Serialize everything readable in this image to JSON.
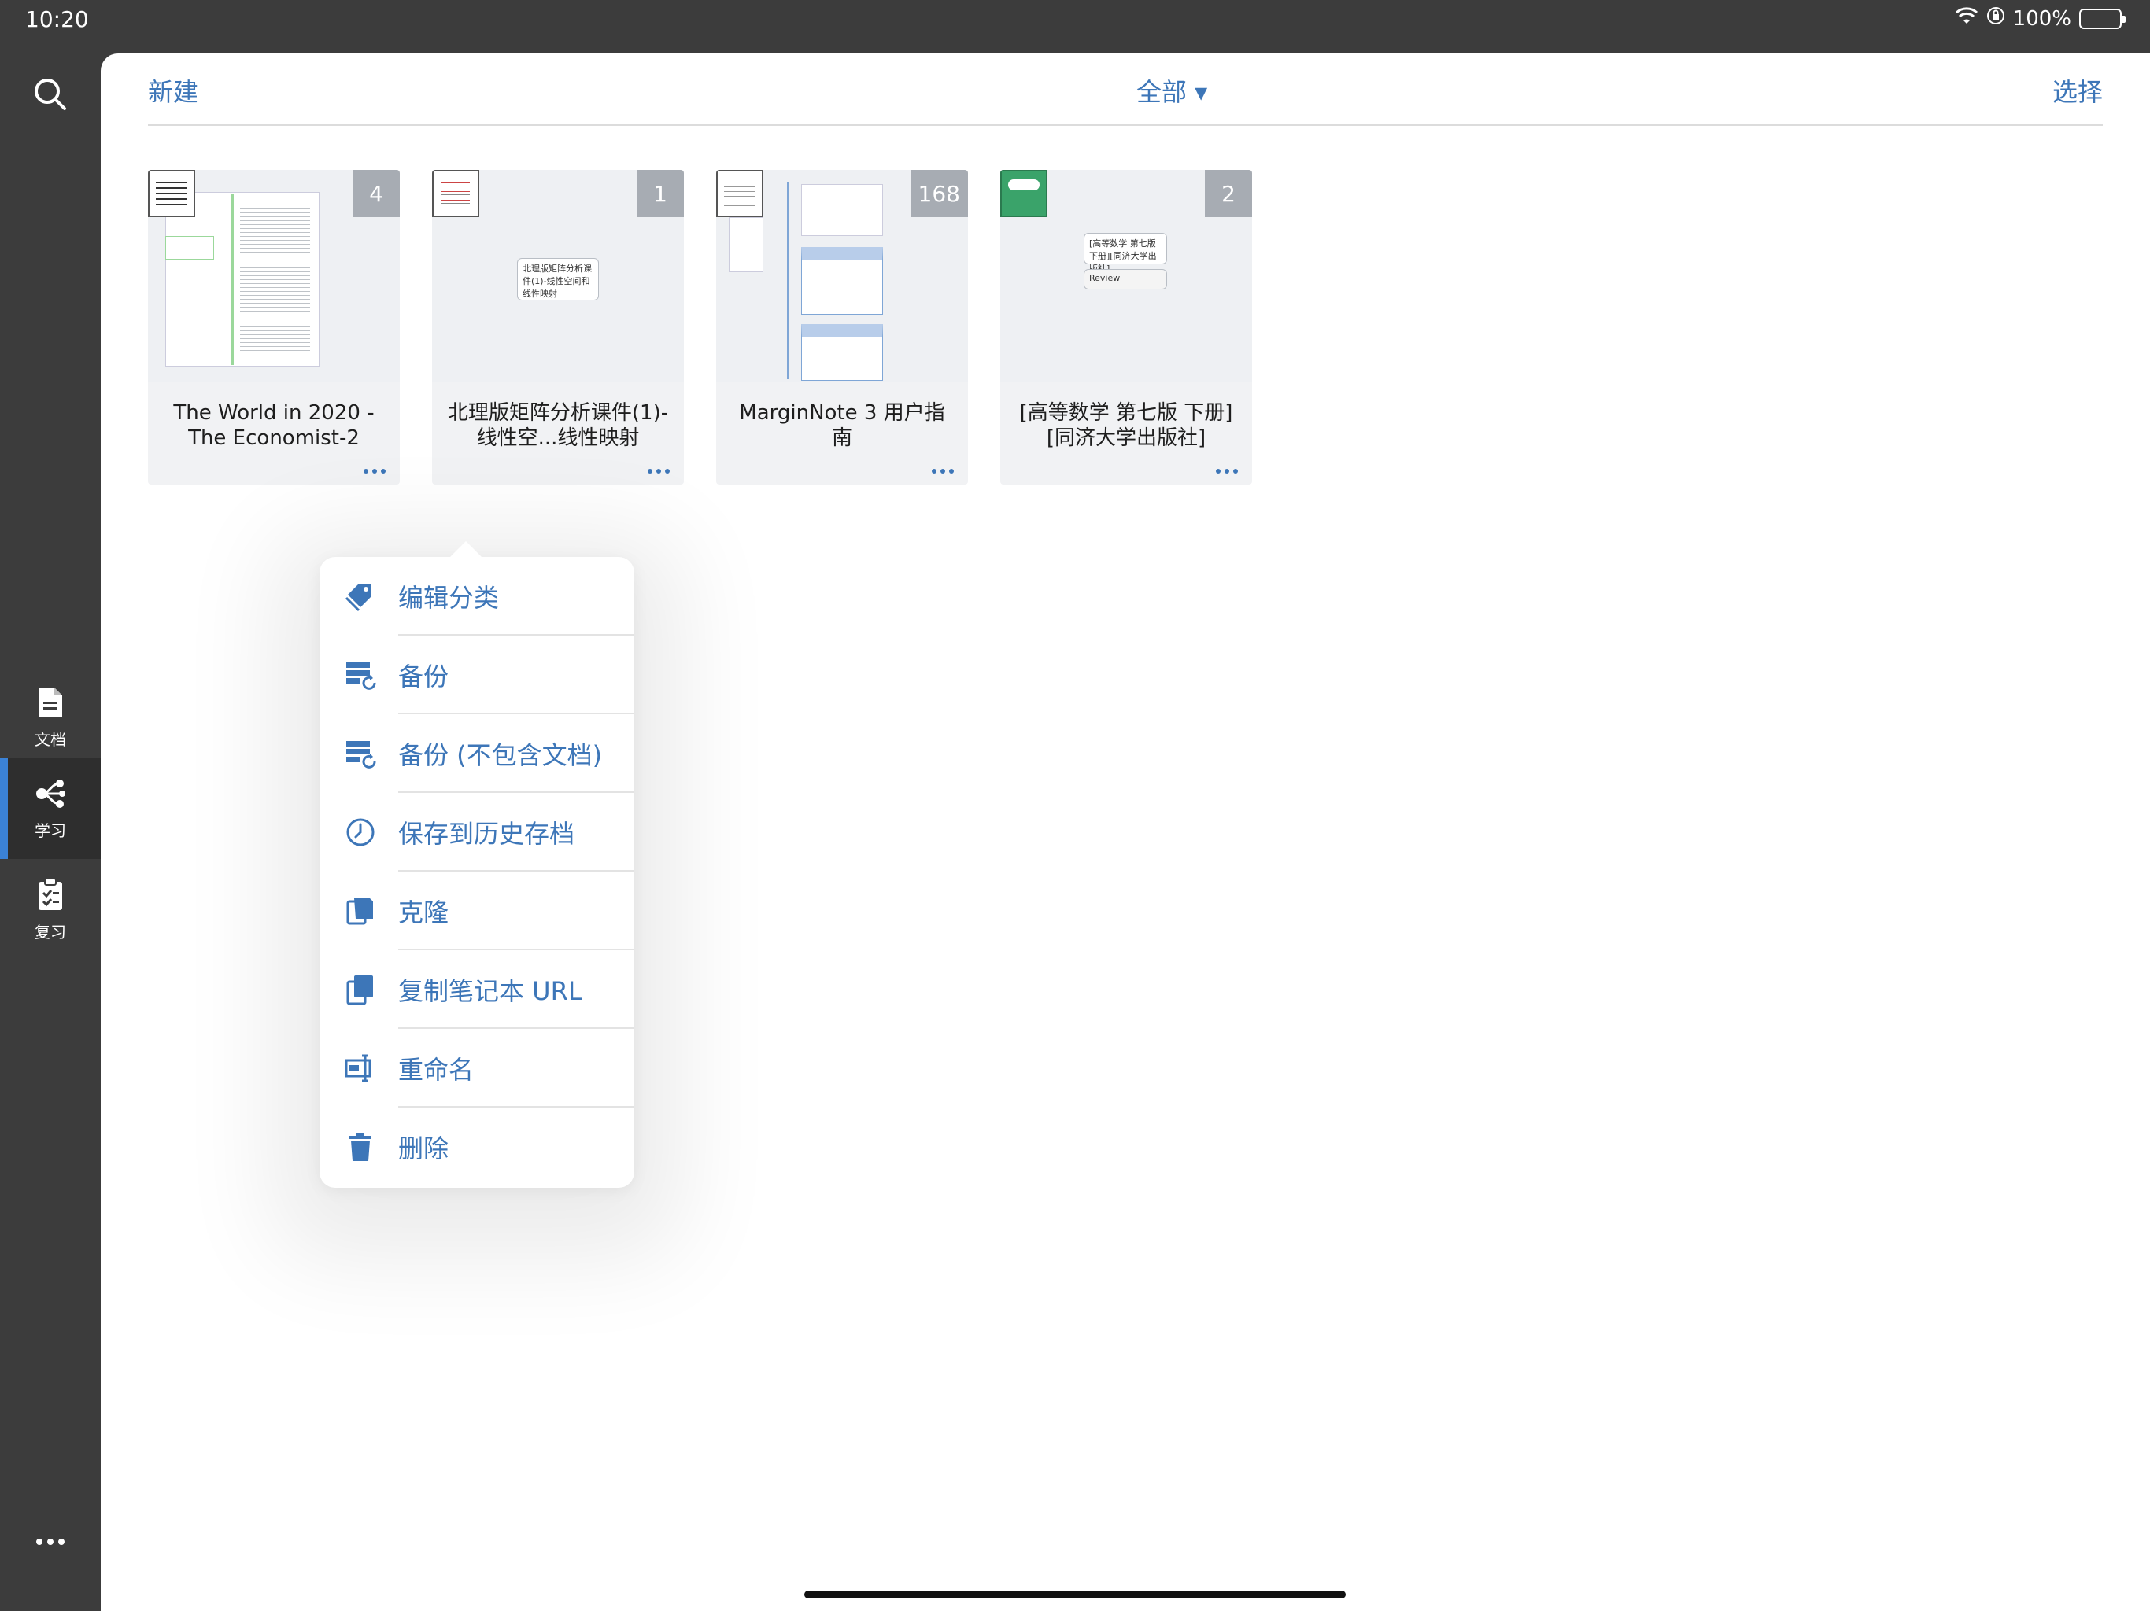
{
  "status": {
    "time": "10:20",
    "battery": "100%",
    "icons": [
      "wifi-icon",
      "orientation-lock-icon",
      "battery-icon"
    ]
  },
  "sidebar": {
    "search_icon": "search-icon",
    "items": [
      {
        "label": "文档",
        "icon": "document-icon",
        "active": false
      },
      {
        "label": "学习",
        "icon": "mindmap-icon",
        "active": true
      },
      {
        "label": "复习",
        "icon": "clipboard-check-icon",
        "active": false
      }
    ],
    "more_icon": "more-horizontal-icon"
  },
  "toolbar": {
    "new_label": "新建",
    "filter_label": "全部 ▾",
    "select_label": "选择"
  },
  "notebooks": [
    {
      "title": "The World in 2020 - The Economist-2",
      "count": "4"
    },
    {
      "title": "北理版矩阵分析课件(1)-线性空...线性映射",
      "count": "1"
    },
    {
      "title": "MarginNote 3 用户指南",
      "count": "168"
    },
    {
      "title": "[高等数学 第七版 下册][同济大学出版社]",
      "count": "2"
    }
  ],
  "thumb_notes": {
    "n2": "北理版矩阵分析课件(1)-线性空间和线性映射",
    "n4a": "[高等数学 第七版 下册][同济大学出版社]",
    "n4b": "Review"
  },
  "context_menu": {
    "items": [
      {
        "label": "编辑分类",
        "icon": "tag-icon"
      },
      {
        "label": "备份",
        "icon": "backup-icon"
      },
      {
        "label": "备份 (不包含文档)",
        "icon": "backup-no-docs-icon"
      },
      {
        "label": "保存到历史存档",
        "icon": "history-clock-icon"
      },
      {
        "label": "克隆",
        "icon": "clone-icon"
      },
      {
        "label": "复制笔记本 URL",
        "icon": "copy-url-icon"
      },
      {
        "label": "重命名",
        "icon": "rename-icon"
      },
      {
        "label": "删除",
        "icon": "trash-icon"
      }
    ]
  },
  "colors": {
    "accent": "#3d76b8",
    "sidebar_bg": "#3c3c3c",
    "active_indicator": "#3b82d6",
    "badge_bg": "#a7acb3"
  }
}
